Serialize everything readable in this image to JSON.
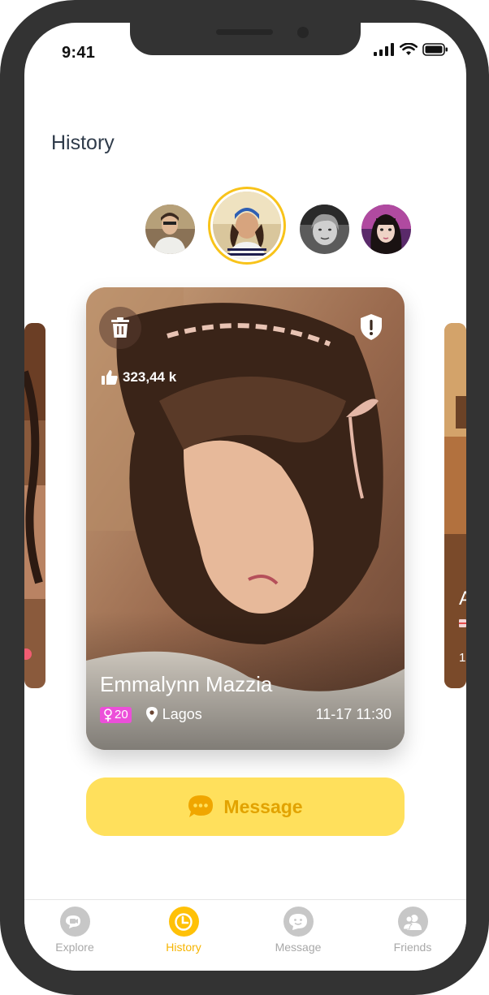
{
  "status_bar": {
    "time": "9:41"
  },
  "page": {
    "title": "History"
  },
  "stories": [
    {
      "name": "story-1"
    },
    {
      "name": "story-2-active"
    },
    {
      "name": "story-3"
    },
    {
      "name": "story-4"
    }
  ],
  "card": {
    "likes": "323,44 k",
    "name": "Emmalynn Mazzia",
    "age": "20",
    "location": "Lagos",
    "time": "11-17 11:30"
  },
  "side_card_right": {
    "initial": "A",
    "time_prefix": "1"
  },
  "actions": {
    "message_label": "Message"
  },
  "tabbar": {
    "items": [
      {
        "label": "Explore",
        "icon": "video-chat-icon"
      },
      {
        "label": "History",
        "icon": "clock-icon"
      },
      {
        "label": "Message",
        "icon": "chat-smile-icon"
      },
      {
        "label": "Friends",
        "icon": "friends-icon"
      }
    ]
  },
  "colors": {
    "accent": "#ffc107",
    "button_bg": "#ffe05c",
    "button_text": "#e2a300",
    "badge": "#ec4fd9",
    "frame": "#333333"
  }
}
